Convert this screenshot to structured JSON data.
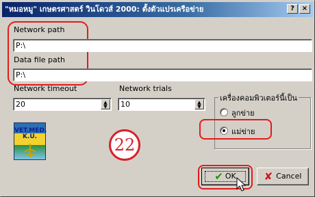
{
  "window": {
    "title": "\"หมอหมู\" เกษตรศาสตร์ วินโดวส์ 2000: ตั้งตัวแปรเครือข่าย",
    "help_button": "?",
    "close_button": "×"
  },
  "fields": {
    "network_path_label": "Network path",
    "network_path_value": "P:\\",
    "data_file_path_label": "Data file path",
    "data_file_path_value": "P:\\",
    "network_timeout_label": "Network timeout",
    "network_timeout_value": "20",
    "network_trials_label": "Network trials",
    "network_trials_value": "10"
  },
  "group": {
    "title": "เครื่องคอมพิวเตอร์นี้เป็น",
    "options": [
      {
        "label": "ลูกข่าย",
        "selected": false
      },
      {
        "label": "แม่ข่าย",
        "selected": true
      }
    ]
  },
  "logo": {
    "line1": "VET.MED.",
    "line2": "K.U."
  },
  "annotation": {
    "step_number": "22",
    "highlight_color": "#e21b1b"
  },
  "buttons": {
    "ok_label": "OK",
    "cancel_label": "Cancel"
  },
  "icons": {
    "ok": "check-icon",
    "cancel": "x-icon",
    "pointer": "mouse-cursor-icon"
  }
}
